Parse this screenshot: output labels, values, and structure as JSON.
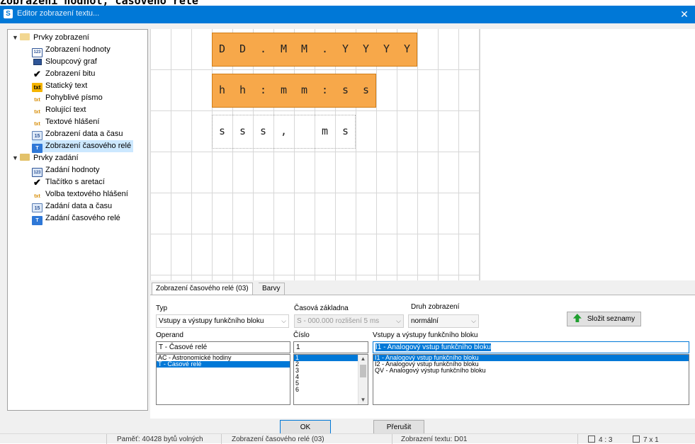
{
  "page_heading": "Zobrazení hodnot, časového relé",
  "window": {
    "title": "Editor zobrazení textu...",
    "close_glyph": "✕"
  },
  "tree": {
    "groups": [
      {
        "label": "Prvky zobrazení",
        "items": [
          {
            "label": "Zobrazení hodnoty",
            "icon": "number-display-icon",
            "glyph": "123"
          },
          {
            "label": "Sloupcový graf",
            "icon": "bar-graph-icon",
            "glyph": ""
          },
          {
            "label": "Zobrazení bitu",
            "icon": "checkmark-icon",
            "glyph": "✔"
          },
          {
            "label": "Statický text",
            "icon": "static-text-icon",
            "glyph": "txt"
          },
          {
            "label": "Pohyblivé písmo",
            "icon": "moving-text-icon",
            "glyph": "txt"
          },
          {
            "label": "Rolující text",
            "icon": "rolling-text-icon",
            "glyph": "txt"
          },
          {
            "label": "Textové hlášení",
            "icon": "text-message-icon",
            "glyph": "txt"
          },
          {
            "label": "Zobrazení data a času",
            "icon": "date-time-icon",
            "glyph": "15"
          },
          {
            "label": "Zobrazení časového relé",
            "icon": "timer-relay-icon",
            "glyph": "T"
          }
        ]
      },
      {
        "label": "Prvky zadání",
        "items": [
          {
            "label": "Zadání hodnoty",
            "icon": "value-input-icon",
            "glyph": "123"
          },
          {
            "label": "Tlačítko s aretací",
            "icon": "latch-button-icon",
            "glyph": "✔"
          },
          {
            "label": "Volba textového hlášení",
            "icon": "message-select-icon",
            "glyph": "txt"
          },
          {
            "label": "Zadání data a času",
            "icon": "date-time-input-icon",
            "glyph": "15"
          },
          {
            "label": "Zadání časového relé",
            "icon": "timer-relay-input-icon",
            "glyph": "T"
          }
        ]
      }
    ],
    "selected_item": "Zobrazení časového relé"
  },
  "display": {
    "row1_chars": [
      "D",
      "D",
      ".",
      "M",
      "M",
      ".",
      "Y",
      "Y",
      "Y",
      "Y"
    ],
    "row2_chars": [
      "h",
      "h",
      ":",
      "m",
      "m",
      ":",
      "s",
      "s"
    ],
    "row3_chars": [
      "s",
      "s",
      "s",
      ",",
      "",
      "m",
      "s"
    ]
  },
  "tabs": [
    {
      "label": "Zobrazení časového relé (03)"
    },
    {
      "label": "Barvy"
    }
  ],
  "form": {
    "typ_label": "Typ",
    "typ_value": "Vstupy a výstupy funkčního bloku",
    "timebase_label": "Časová základna",
    "timebase_value": "S - 000.000 rozlišení 5 ms",
    "display_kind_label": "Druh zobrazení",
    "display_kind_value": "normální",
    "compose_button": "Složit seznamy",
    "operand_label": "Operand",
    "operand_value": "T - Časové relé",
    "operand_options": [
      "AC - Astronomické hodiny",
      "T - Časové relé"
    ],
    "number_label": "Číslo",
    "number_value": "1",
    "number_options": [
      "1",
      "2",
      "3",
      "4",
      "5",
      "6"
    ],
    "io_label": "Vstupy a výstupy funkčního bloku",
    "io_value": "I1 - Analogový vstup funkčního bloku",
    "io_options": [
      "I1 - Analogový vstup funkčního bloku",
      "I2 - Analogový vstup funkčního bloku",
      "QV - Analogový výstup funkčního bloku"
    ]
  },
  "buttons": {
    "ok": "OK",
    "cancel": "Přerušit"
  },
  "status": {
    "memory": "Paměť: 40428 bytů volných",
    "element": "Zobrazení časového relé (03)",
    "text_display": "Zobrazení textu: D01",
    "ratio": "4 : 3",
    "size": "7 x 1"
  },
  "colors": {
    "accent": "#0078d7",
    "cell_fill": "#f7a84a"
  }
}
